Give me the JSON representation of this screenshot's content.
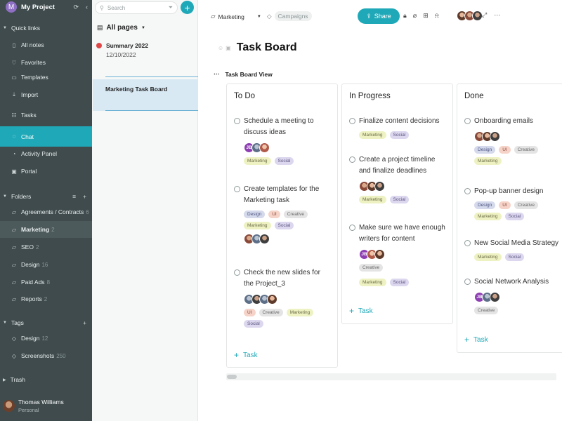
{
  "sidebar": {
    "project_initial": "M",
    "project_name": "My Project",
    "quick_links_label": "Quick links",
    "quick_links": [
      {
        "label": "All notes"
      },
      {
        "label": "Favorites"
      },
      {
        "label": "Templates"
      },
      {
        "label": "Import"
      },
      {
        "label": "Tasks"
      },
      {
        "label": "Chat"
      },
      {
        "label": "Activity Panel"
      },
      {
        "label": "Portal"
      }
    ],
    "folders_label": "Folders",
    "folders": [
      {
        "label": "Agreements / Contracts",
        "count": "6"
      },
      {
        "label": "Marketing",
        "count": "2"
      },
      {
        "label": "SEO",
        "count": "2"
      },
      {
        "label": "Design",
        "count": "16"
      },
      {
        "label": "Paid Ads",
        "count": "8"
      },
      {
        "label": "Reports",
        "count": "2"
      }
    ],
    "tags_label": "Tags",
    "tags": [
      {
        "label": "Design",
        "count": "12"
      },
      {
        "label": "Screenshots",
        "count": "250"
      }
    ],
    "trash_label": "Trash",
    "user": {
      "name": "Thomas Williams",
      "role": "Personal"
    }
  },
  "pages_panel": {
    "search_placeholder": "Search",
    "all_pages_label": "All pages",
    "items": [
      {
        "title": "Summary 2022",
        "date": "12/10/2022"
      },
      {
        "title": "Marketing Task Board"
      }
    ]
  },
  "topbar": {
    "folder": "Marketing",
    "tag": "Campaigns",
    "share_label": "Share"
  },
  "page": {
    "title": "Task Board",
    "view_label": "Task Board View"
  },
  "board": {
    "add_task_label": "Task",
    "columns": [
      {
        "title": "To Do",
        "cards": [
          {
            "title": "Schedule a meeting to discuss ideas",
            "avatar_initials": "JB",
            "tags": [
              "Marketing",
              "Social"
            ]
          },
          {
            "title": "Create templates for the Marketing task",
            "tags": [
              "Design",
              "UI",
              "Creative",
              "Marketing",
              "Social"
            ]
          },
          {
            "title": "Check the new slides for the Project_3",
            "tags": [
              "UI",
              "Creative",
              "Marketing",
              "Social"
            ]
          }
        ]
      },
      {
        "title": "In Progress",
        "cards": [
          {
            "title": "Finalize content decisions",
            "tags": [
              "Marketing",
              "Social"
            ]
          },
          {
            "title": "Create a project timeline and finalize deadlines",
            "tags": [
              "Marketing",
              "Social"
            ]
          },
          {
            "title": "Make sure we have enough writers for content",
            "avatar_initials": "JB",
            "tags": [
              "Creative",
              "Marketing",
              "Social"
            ]
          }
        ]
      },
      {
        "title": "Done",
        "cards": [
          {
            "title": "Onboarding emails",
            "tags": [
              "Design",
              "UI",
              "Creative",
              "Marketing"
            ]
          },
          {
            "title": "Pop-up banner design",
            "tags": [
              "Design",
              "UI",
              "Creative",
              "Marketing",
              "Social"
            ]
          },
          {
            "title": "New Social Media Strategy",
            "tags": [
              "Marketing",
              "Social"
            ]
          },
          {
            "title": "Social Network Analysis",
            "avatar_initials": "JB",
            "tags": [
              "Creative"
            ]
          }
        ]
      }
    ]
  },
  "colors": {
    "sidebar_bg": "#3f4b4d",
    "accent": "#1fa9b8",
    "selected_page": "#d8e9f4"
  }
}
